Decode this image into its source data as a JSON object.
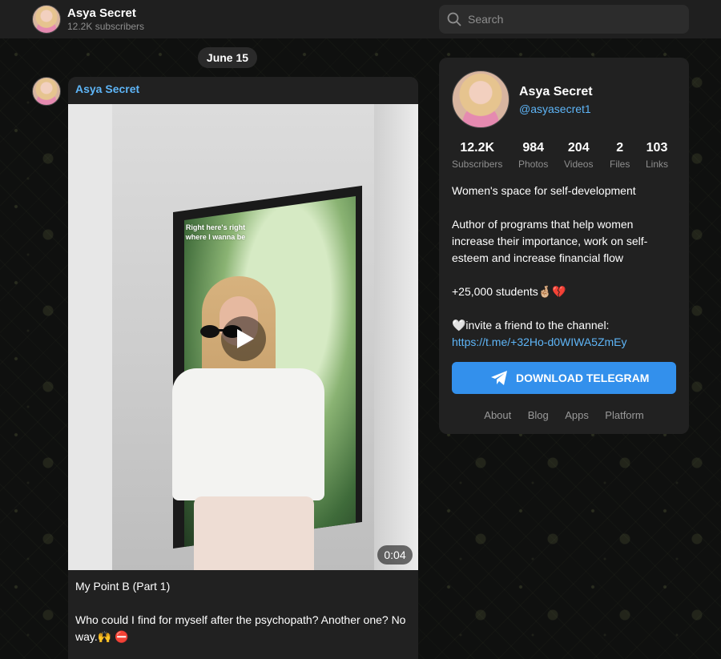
{
  "header": {
    "channel_name": "Asya Secret",
    "subscribers": "12.2K subscribers",
    "search_placeholder": "Search"
  },
  "feed": {
    "date_label": "June 15",
    "post": {
      "author": "Asya Secret",
      "video_overlay_text": "Right here's right where I wanna be",
      "duration": "0:04",
      "text_lines": [
        "My Point B (Part 1)",
        "Who could I find for myself after the psychopath? Another one? No way.🙌 ⛔"
      ]
    }
  },
  "channel_card": {
    "name": "Asya Secret",
    "handle": "@asyasecret1",
    "stats": [
      {
        "value": "12.2K",
        "label": "Subscribers"
      },
      {
        "value": "984",
        "label": "Photos"
      },
      {
        "value": "204",
        "label": "Videos"
      },
      {
        "value": "2",
        "label": "Files"
      },
      {
        "value": "103",
        "label": "Links"
      }
    ],
    "description": [
      "Women's space for self-development",
      "Author of programs that help women increase their importance, work on self-esteem and increase financial flow",
      "+25,000 students🤞🏼💔",
      "🤍invite a friend to the channel:"
    ],
    "invite_link": "https://t.me/+32Ho-d0WIWA5ZmEy",
    "download_button": "DOWNLOAD TELEGRAM",
    "footer_links": [
      "About",
      "Blog",
      "Apps",
      "Platform"
    ]
  },
  "colors": {
    "accent": "#5eb5f7",
    "button": "#3390ec",
    "panel": "#212121"
  }
}
